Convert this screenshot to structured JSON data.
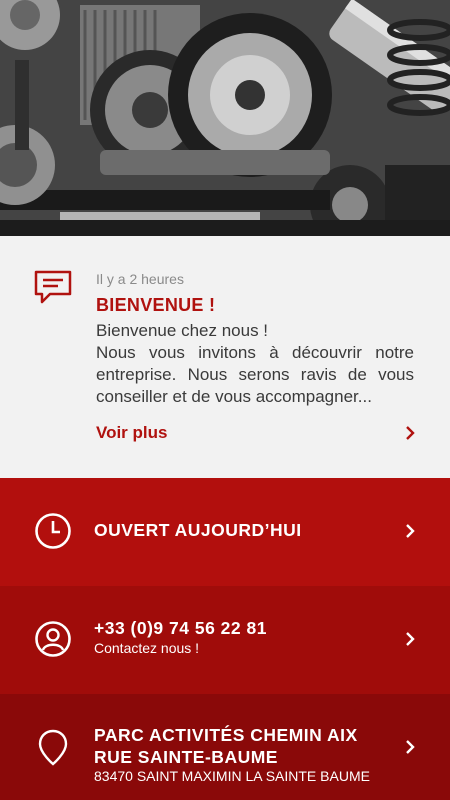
{
  "hero": {
    "image": "auto-parts-photo"
  },
  "news": {
    "icon": "message-icon",
    "time": "Il y a 2 heures",
    "title": "BIENVENUE !",
    "body": "Bienvenue chez nous !\nNous vous invitons à découvrir notre entreprise. Nous serons ravis de vous conseiller et de vous accompagner...",
    "more_label": "Voir plus"
  },
  "hours": {
    "icon": "clock-icon",
    "title": "OUVERT AUJOURD’HUI"
  },
  "phone": {
    "icon": "user-icon",
    "title": "+33 (0)9 74 56 22 81",
    "subtitle": "Contactez nous !"
  },
  "address": {
    "icon": "location-pin-icon",
    "title": "PARC ACTIVITÉS CHEMIN AIX RUE SAINTE-BAUME",
    "subtitle": "83470 SAINT MAXIMIN LA SAINTE BAUME"
  },
  "colors": {
    "accent": "#b0120f",
    "row1": "#b20f0d",
    "row2": "#a00c0a",
    "row3": "#8a0909"
  }
}
